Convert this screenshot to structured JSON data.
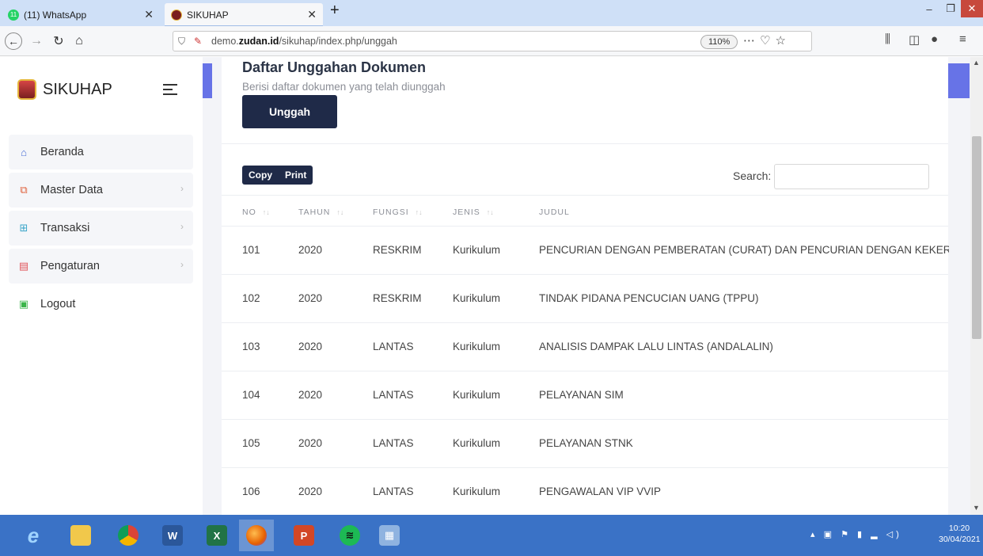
{
  "browser": {
    "tabs": [
      {
        "title": "(11) WhatsApp",
        "active": false
      },
      {
        "title": "SIKUHAP",
        "active": true
      }
    ],
    "url_prefix": "demo.",
    "url_domain": "zudan.id",
    "url_path": "/sikuhap/index.php/unggah",
    "zoom": "110%"
  },
  "sidebar": {
    "brand": "SIKUHAP",
    "items": [
      {
        "label": "Beranda",
        "icon": "home-icon"
      },
      {
        "label": "Master Data",
        "icon": "copy-icon"
      },
      {
        "label": "Transaksi",
        "icon": "grid-icon"
      },
      {
        "label": "Pengaturan",
        "icon": "document-icon"
      },
      {
        "label": "Logout",
        "icon": "lock-icon"
      }
    ]
  },
  "main": {
    "title": "Daftar Unggahan Dokumen",
    "subtitle": "Berisi daftar dokumen yang telah diunggah",
    "upload_label": "Unggah",
    "copy_label": "Copy",
    "print_label": "Print",
    "search_label": "Search:",
    "search_value": "",
    "columns": [
      "NO",
      "TAHUN",
      "FUNGSI",
      "JENIS",
      "JUDUL"
    ],
    "rows": [
      {
        "no": "101",
        "tahun": "2020",
        "fungsi": "RESKRIM",
        "jenis": "Kurikulum",
        "judul": "PENCURIAN DENGAN PEMBERATAN (CURAT) DAN PENCURIAN DENGAN KEKERASAN (C"
      },
      {
        "no": "102",
        "tahun": "2020",
        "fungsi": "RESKRIM",
        "jenis": "Kurikulum",
        "judul": "TINDAK PIDANA PENCUCIAN UANG (TPPU)"
      },
      {
        "no": "103",
        "tahun": "2020",
        "fungsi": "LANTAS",
        "jenis": "Kurikulum",
        "judul": "ANALISIS DAMPAK LALU LINTAS (ANDALALIN)"
      },
      {
        "no": "104",
        "tahun": "2020",
        "fungsi": "LANTAS",
        "jenis": "Kurikulum",
        "judul": "PELAYANAN SIM"
      },
      {
        "no": "105",
        "tahun": "2020",
        "fungsi": "LANTAS",
        "jenis": "Kurikulum",
        "judul": "PELAYANAN STNK"
      },
      {
        "no": "106",
        "tahun": "2020",
        "fungsi": "LANTAS",
        "jenis": "Kurikulum",
        "judul": "PENGAWALAN VIP VVIP"
      }
    ]
  },
  "taskbar": {
    "time": "10:20",
    "date": "30/04/2021"
  },
  "colors": {
    "primary": "#1f2a48",
    "accent": "#6773e7",
    "tabbar": "#cfe0f7",
    "taskbar": "#3a72c6"
  }
}
